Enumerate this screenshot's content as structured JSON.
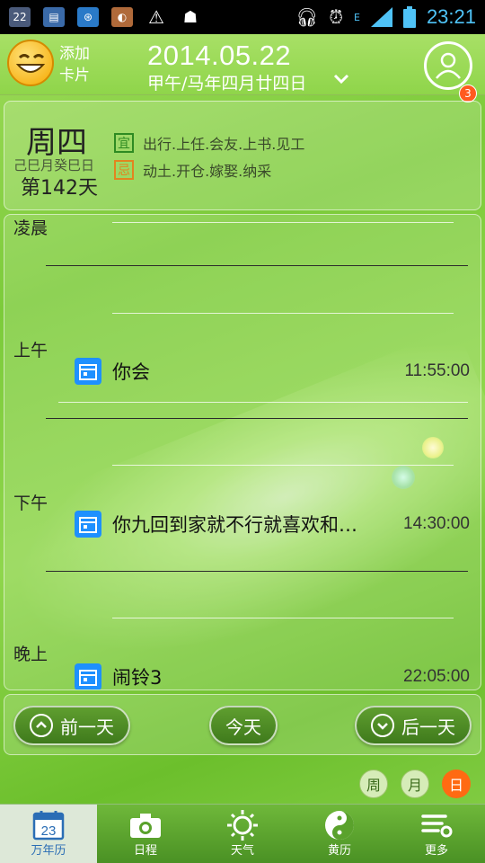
{
  "statusbar": {
    "time": "23:21",
    "signal_label": "E"
  },
  "header": {
    "add_card": "添加\n卡片",
    "add_line1": "添加",
    "add_line2": "卡片",
    "date": "2014.05.22",
    "lunar": "甲午/马年四月廿四日",
    "badge_count": "3"
  },
  "day": {
    "weekday": "周四",
    "ganzhi": "己巳月癸巳日",
    "day_of_year": "第142天",
    "yi_label": "宜",
    "yi_text": "出行.上任.会友.上书.见工",
    "ji_label": "忌",
    "ji_text": "动土.开仓.嫁娶.纳采"
  },
  "schedule": {
    "periods": [
      "凌晨",
      "上午",
      "下午",
      "晚上"
    ],
    "events": [
      {
        "title": "你会",
        "time": "11:55:00"
      },
      {
        "title": "你九回到家就不行就喜欢和…",
        "time": "14:30:00"
      },
      {
        "title": "闹铃3",
        "time": "22:05:00"
      }
    ]
  },
  "nav": {
    "prev": "前一天",
    "today": "今天",
    "next": "后一天"
  },
  "view_switch": {
    "week": "周",
    "month": "月",
    "day": "日",
    "active": "日"
  },
  "tabs": [
    {
      "label": "万年历",
      "icon": "calendar-icon",
      "day": "23"
    },
    {
      "label": "日程",
      "icon": "camera-icon"
    },
    {
      "label": "天气",
      "icon": "sun-icon"
    },
    {
      "label": "黄历",
      "icon": "yin-yang-icon"
    },
    {
      "label": "更多",
      "icon": "more-settings-icon"
    }
  ],
  "colors": {
    "accent_orange": "#ff6a12",
    "event_blue": "#1e90ff",
    "yi_green": "#2e8b22",
    "ji_orange": "#e2841f",
    "time_blue": "#4fc3f7"
  }
}
